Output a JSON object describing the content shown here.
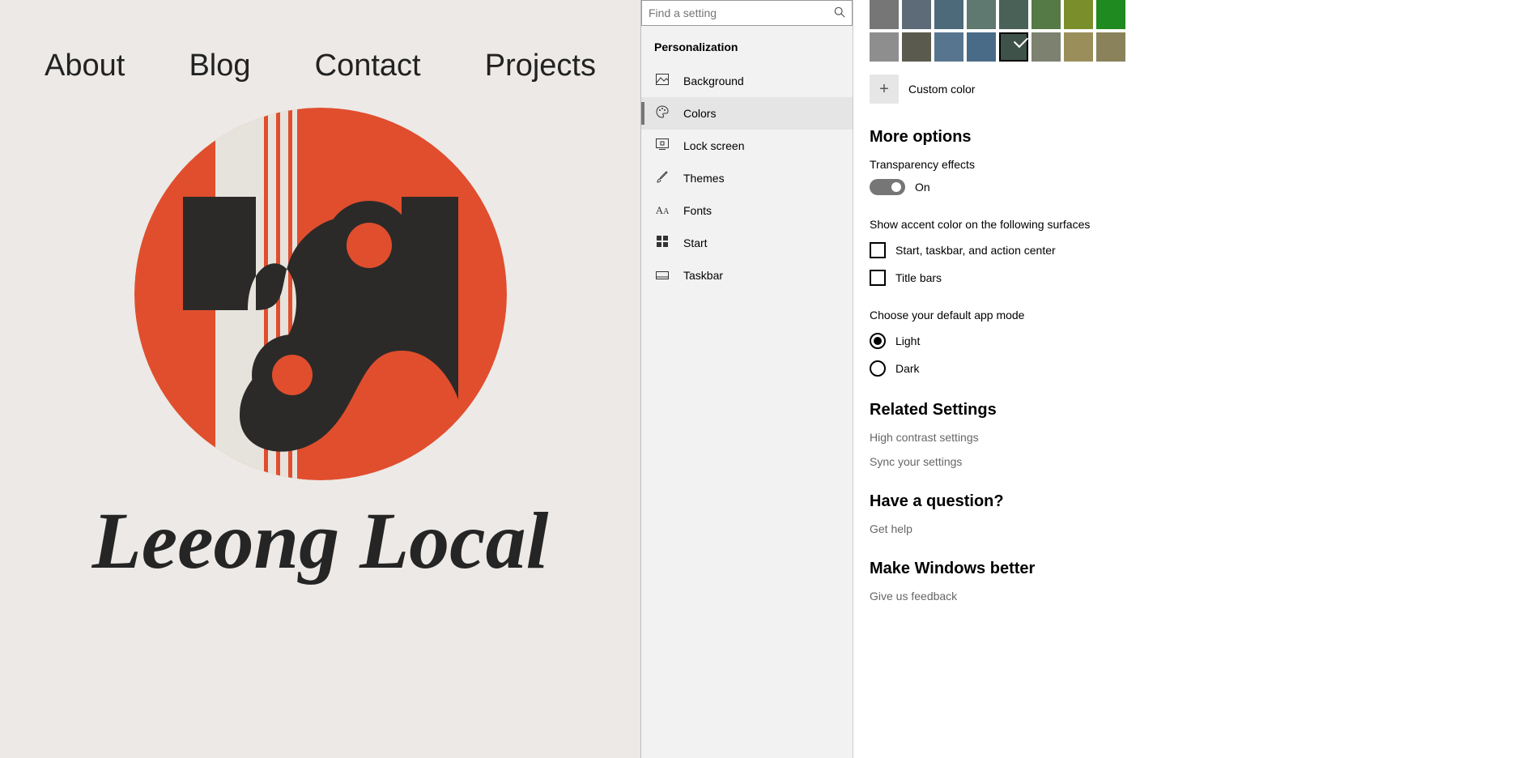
{
  "website": {
    "nav": [
      "About",
      "Blog",
      "Contact",
      "Projects"
    ],
    "title": "Leeong Local",
    "logo_colors": {
      "bg": "#e04e2e",
      "shape": "#2b2a28",
      "stripe": "#e6e3dc"
    }
  },
  "sidebar": {
    "search_placeholder": "Find a setting",
    "section": "Personalization",
    "items": [
      {
        "label": "Background",
        "icon": "🖼"
      },
      {
        "label": "Colors",
        "icon": "🎨",
        "selected": true
      },
      {
        "label": "Lock screen",
        "icon": "🔒"
      },
      {
        "label": "Themes",
        "icon": "🖌"
      },
      {
        "label": "Fonts",
        "icon": "A"
      },
      {
        "label": "Start",
        "icon": "▦"
      },
      {
        "label": "Taskbar",
        "icon": "▭"
      }
    ]
  },
  "content": {
    "swatch_rows": [
      [
        "#767676",
        "#5d6b78",
        "#4c6a7a",
        "#5f7970",
        "#4a6157",
        "#557a46",
        "#7a8f2b",
        "#1f8a1f"
      ],
      [
        "#8e8e8e",
        "#5a5a4e",
        "#58758f",
        "#496b87",
        "#3f524a",
        "#7d8170",
        "#9a8e5a",
        "#8a825b"
      ]
    ],
    "selected_swatch": "1-4",
    "custom_color_label": "Custom color",
    "more_options_heading": "More options",
    "transparency_label": "Transparency effects",
    "transparency_state": "On",
    "accent_surfaces_label": "Show accent color on the following surfaces",
    "checkbox1": "Start, taskbar, and action center",
    "checkbox2": "Title bars",
    "app_mode_label": "Choose your default app mode",
    "radio_light": "Light",
    "radio_dark": "Dark",
    "related_heading": "Related Settings",
    "related_links": [
      "High contrast settings",
      "Sync your settings"
    ],
    "question_heading": "Have a question?",
    "question_link": "Get help",
    "better_heading": "Make Windows better",
    "better_link": "Give us feedback"
  }
}
